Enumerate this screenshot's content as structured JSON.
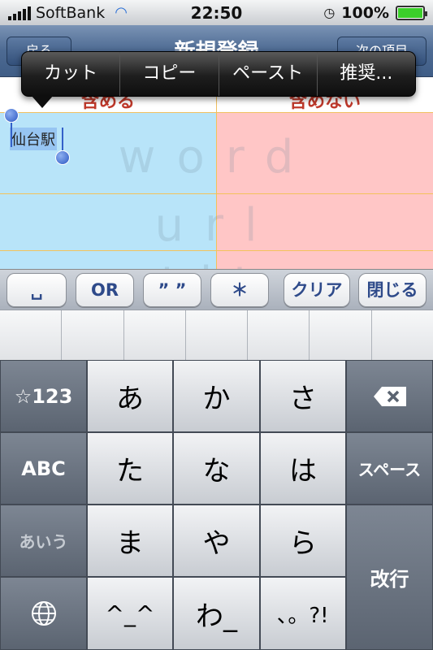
{
  "status_bar": {
    "carrier": "SoftBank",
    "time": "22:50",
    "battery_percent": "100%",
    "battery_level": 1.0
  },
  "nav_bar": {
    "back_label": "戻る",
    "title": "新規登録",
    "right_label": "次の項目"
  },
  "content": {
    "columns": [
      "含める",
      "含めない"
    ],
    "selected_text": "仙台駅",
    "watermark_lines": [
      "word",
      "url",
      "tit"
    ]
  },
  "edit_menu": {
    "items": [
      "カット",
      "コピー",
      "ペースト",
      "推奨..."
    ]
  },
  "accessory_bar": {
    "buttons": [
      "␣",
      "OR",
      "” ”",
      "＊",
      "クリア",
      "閉じる"
    ]
  },
  "keyboard": {
    "mode_number": "☆123",
    "mode_abc": "ABC",
    "mode_kana": "あいう",
    "globe_icon": "globe-icon",
    "keys_row1": [
      "あ",
      "か",
      "さ"
    ],
    "keys_row2": [
      "た",
      "な",
      "は"
    ],
    "keys_row3": [
      "ま",
      "や",
      "ら"
    ],
    "keys_row4": [
      "^_^",
      "わ_",
      "､。?!"
    ],
    "backspace_icon": "backspace-icon",
    "space_label": "スペース",
    "return_label": "改行"
  }
}
